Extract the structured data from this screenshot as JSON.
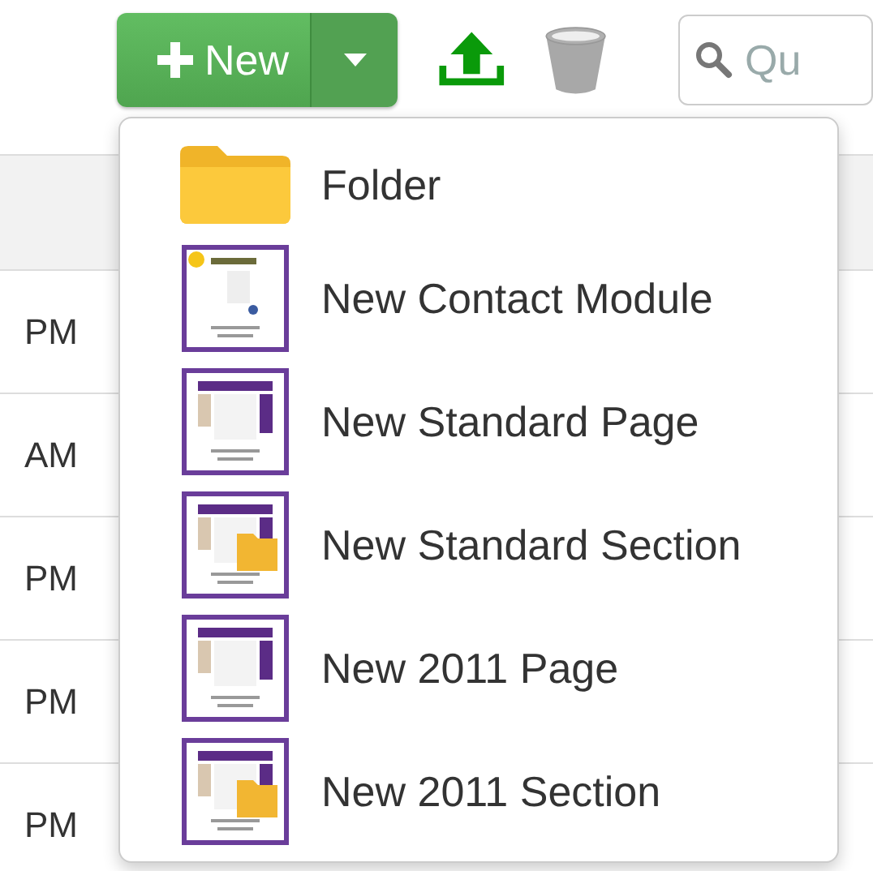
{
  "toolbar": {
    "new_button": {
      "label": "New"
    },
    "search": {
      "placeholder": "Qu"
    }
  },
  "table": {
    "rows": [
      {
        "column_1": "PM"
      },
      {
        "column_1": "AM"
      },
      {
        "column_1": "PM"
      },
      {
        "column_1": "PM"
      },
      {
        "column_1": "PM"
      }
    ]
  },
  "new_menu": {
    "items": [
      {
        "kind": "folder",
        "label": "Folder"
      },
      {
        "kind": "module",
        "label": "New Contact Module"
      },
      {
        "kind": "page",
        "label": "New Standard Page"
      },
      {
        "kind": "section",
        "label": "New Standard Section"
      },
      {
        "kind": "page",
        "label": "New 2011 Page"
      },
      {
        "kind": "section",
        "label": "New 2011 Section"
      }
    ]
  }
}
